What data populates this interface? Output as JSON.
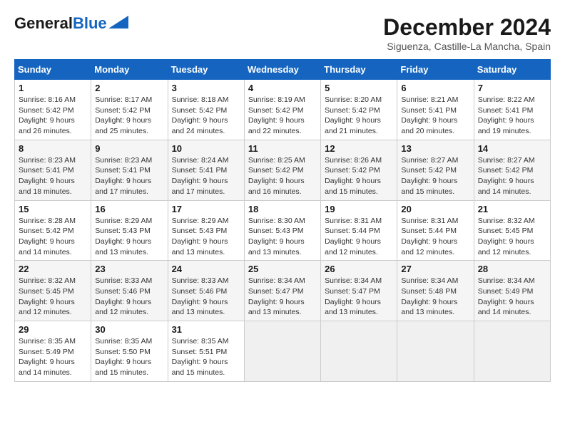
{
  "header": {
    "logo_general": "General",
    "logo_blue": "Blue",
    "month_title": "December 2024",
    "location": "Siguenza, Castille-La Mancha, Spain"
  },
  "weekdays": [
    "Sunday",
    "Monday",
    "Tuesday",
    "Wednesday",
    "Thursday",
    "Friday",
    "Saturday"
  ],
  "weeks": [
    [
      {
        "day": "1",
        "sunrise": "8:16 AM",
        "sunset": "5:42 PM",
        "daylight": "9 hours and 26 minutes."
      },
      {
        "day": "2",
        "sunrise": "8:17 AM",
        "sunset": "5:42 PM",
        "daylight": "9 hours and 25 minutes."
      },
      {
        "day": "3",
        "sunrise": "8:18 AM",
        "sunset": "5:42 PM",
        "daylight": "9 hours and 24 minutes."
      },
      {
        "day": "4",
        "sunrise": "8:19 AM",
        "sunset": "5:42 PM",
        "daylight": "9 hours and 22 minutes."
      },
      {
        "day": "5",
        "sunrise": "8:20 AM",
        "sunset": "5:42 PM",
        "daylight": "9 hours and 21 minutes."
      },
      {
        "day": "6",
        "sunrise": "8:21 AM",
        "sunset": "5:41 PM",
        "daylight": "9 hours and 20 minutes."
      },
      {
        "day": "7",
        "sunrise": "8:22 AM",
        "sunset": "5:41 PM",
        "daylight": "9 hours and 19 minutes."
      }
    ],
    [
      {
        "day": "8",
        "sunrise": "8:23 AM",
        "sunset": "5:41 PM",
        "daylight": "9 hours and 18 minutes."
      },
      {
        "day": "9",
        "sunrise": "8:23 AM",
        "sunset": "5:41 PM",
        "daylight": "9 hours and 17 minutes."
      },
      {
        "day": "10",
        "sunrise": "8:24 AM",
        "sunset": "5:41 PM",
        "daylight": "9 hours and 17 minutes."
      },
      {
        "day": "11",
        "sunrise": "8:25 AM",
        "sunset": "5:42 PM",
        "daylight": "9 hours and 16 minutes."
      },
      {
        "day": "12",
        "sunrise": "8:26 AM",
        "sunset": "5:42 PM",
        "daylight": "9 hours and 15 minutes."
      },
      {
        "day": "13",
        "sunrise": "8:27 AM",
        "sunset": "5:42 PM",
        "daylight": "9 hours and 15 minutes."
      },
      {
        "day": "14",
        "sunrise": "8:27 AM",
        "sunset": "5:42 PM",
        "daylight": "9 hours and 14 minutes."
      }
    ],
    [
      {
        "day": "15",
        "sunrise": "8:28 AM",
        "sunset": "5:42 PM",
        "daylight": "9 hours and 14 minutes."
      },
      {
        "day": "16",
        "sunrise": "8:29 AM",
        "sunset": "5:43 PM",
        "daylight": "9 hours and 13 minutes."
      },
      {
        "day": "17",
        "sunrise": "8:29 AM",
        "sunset": "5:43 PM",
        "daylight": "9 hours and 13 minutes."
      },
      {
        "day": "18",
        "sunrise": "8:30 AM",
        "sunset": "5:43 PM",
        "daylight": "9 hours and 13 minutes."
      },
      {
        "day": "19",
        "sunrise": "8:31 AM",
        "sunset": "5:44 PM",
        "daylight": "9 hours and 12 minutes."
      },
      {
        "day": "20",
        "sunrise": "8:31 AM",
        "sunset": "5:44 PM",
        "daylight": "9 hours and 12 minutes."
      },
      {
        "day": "21",
        "sunrise": "8:32 AM",
        "sunset": "5:45 PM",
        "daylight": "9 hours and 12 minutes."
      }
    ],
    [
      {
        "day": "22",
        "sunrise": "8:32 AM",
        "sunset": "5:45 PM",
        "daylight": "9 hours and 12 minutes."
      },
      {
        "day": "23",
        "sunrise": "8:33 AM",
        "sunset": "5:46 PM",
        "daylight": "9 hours and 12 minutes."
      },
      {
        "day": "24",
        "sunrise": "8:33 AM",
        "sunset": "5:46 PM",
        "daylight": "9 hours and 13 minutes."
      },
      {
        "day": "25",
        "sunrise": "8:34 AM",
        "sunset": "5:47 PM",
        "daylight": "9 hours and 13 minutes."
      },
      {
        "day": "26",
        "sunrise": "8:34 AM",
        "sunset": "5:47 PM",
        "daylight": "9 hours and 13 minutes."
      },
      {
        "day": "27",
        "sunrise": "8:34 AM",
        "sunset": "5:48 PM",
        "daylight": "9 hours and 13 minutes."
      },
      {
        "day": "28",
        "sunrise": "8:34 AM",
        "sunset": "5:49 PM",
        "daylight": "9 hours and 14 minutes."
      }
    ],
    [
      {
        "day": "29",
        "sunrise": "8:35 AM",
        "sunset": "5:49 PM",
        "daylight": "9 hours and 14 minutes."
      },
      {
        "day": "30",
        "sunrise": "8:35 AM",
        "sunset": "5:50 PM",
        "daylight": "9 hours and 15 minutes."
      },
      {
        "day": "31",
        "sunrise": "8:35 AM",
        "sunset": "5:51 PM",
        "daylight": "9 hours and 15 minutes."
      },
      null,
      null,
      null,
      null
    ]
  ]
}
